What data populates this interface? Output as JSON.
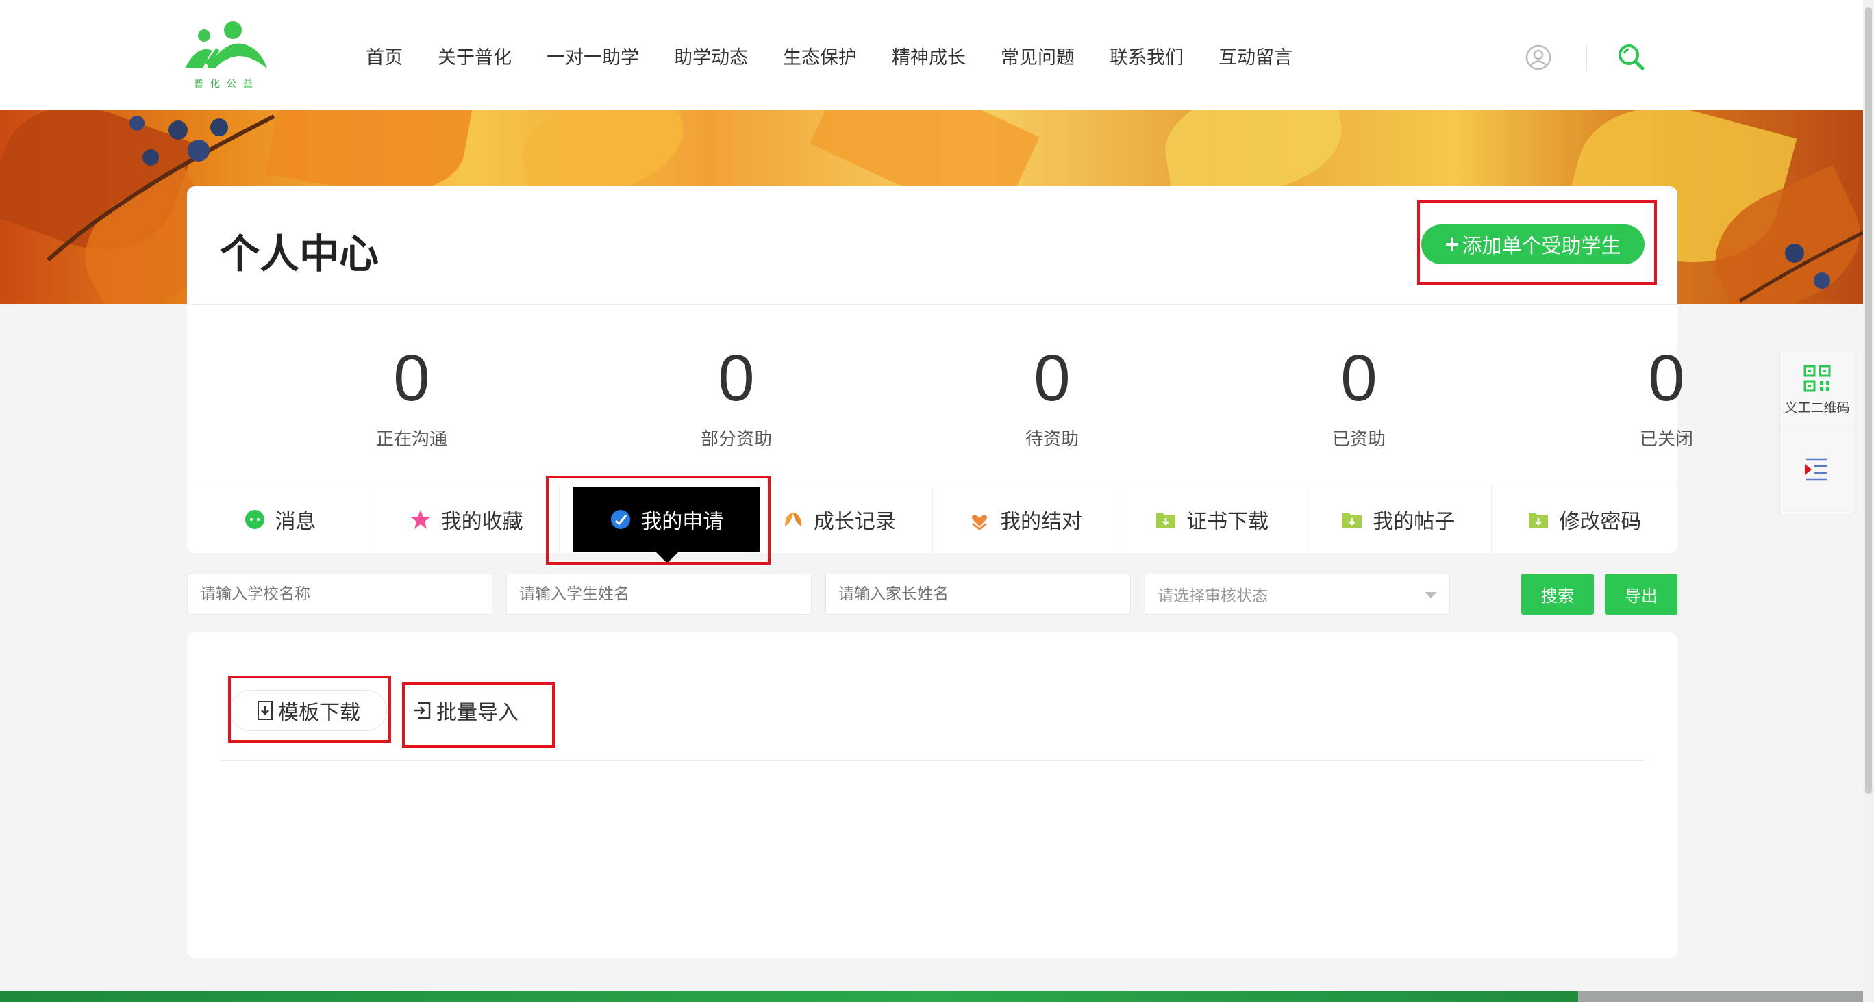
{
  "header": {
    "logo_text": "普化公益",
    "nav": [
      "首页",
      "关于普化",
      "一对一助学",
      "助学动态",
      "生态保护",
      "精神成长",
      "常见问题",
      "联系我们",
      "互动留言"
    ]
  },
  "page": {
    "title": "个人中心",
    "add_button": "添加单个受助学生"
  },
  "stats": [
    {
      "value": "0",
      "label": "正在沟通"
    },
    {
      "value": "0",
      "label": "部分资助"
    },
    {
      "value": "0",
      "label": "待资助"
    },
    {
      "value": "0",
      "label": "已资助"
    },
    {
      "value": "0",
      "label": "已关闭"
    }
  ],
  "tabs": [
    {
      "label": "消息",
      "icon": "chat-icon"
    },
    {
      "label": "我的收藏",
      "icon": "star-icon"
    },
    {
      "label": "我的申请",
      "icon": "apply-icon",
      "active": true
    },
    {
      "label": "成长记录",
      "icon": "leaf-icon"
    },
    {
      "label": "我的结对",
      "icon": "heart-hand-icon"
    },
    {
      "label": "证书下载",
      "icon": "folder-icon"
    },
    {
      "label": "我的帖子",
      "icon": "folder-icon"
    },
    {
      "label": "修改密码",
      "icon": "folder-icon"
    }
  ],
  "filters": {
    "school_placeholder": "请输入学校名称",
    "student_placeholder": "请输入学生姓名",
    "parent_placeholder": "请输入家长姓名",
    "status_placeholder": "请选择审核状态",
    "search_label": "搜索",
    "export_label": "导出"
  },
  "content": {
    "template_download": "模板下载",
    "batch_import": "批量导入"
  },
  "side": {
    "qr_label": "义工二维码"
  },
  "colors": {
    "accent": "#2dc653",
    "highlight": "#e0121e"
  }
}
